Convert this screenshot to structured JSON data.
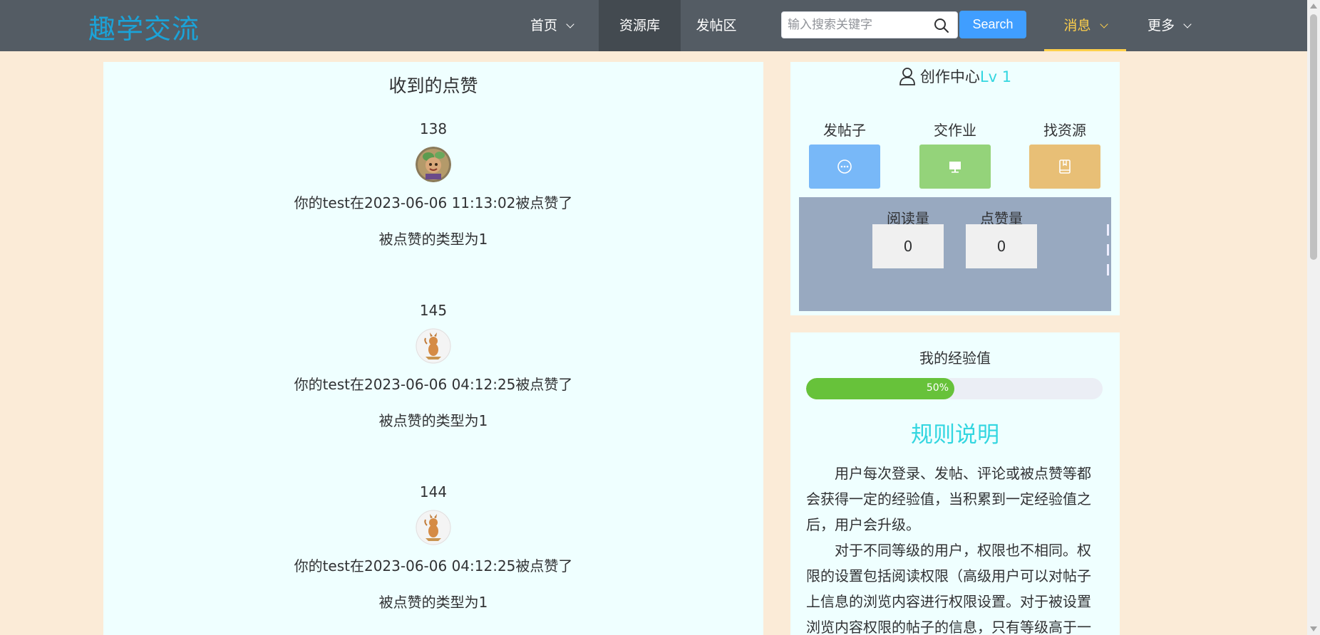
{
  "header": {
    "logo": "趣学交流",
    "nav": {
      "home": "首页",
      "resources": "资源库",
      "posts": "发帖区",
      "messages": "消息",
      "more": "更多"
    },
    "search": {
      "placeholder": "输入搜索关键字",
      "button": "Search"
    }
  },
  "likes": {
    "title": "收到的点赞",
    "items": [
      {
        "id": "138",
        "message": "你的test在2023-06-06 11:13:02被点赞了",
        "type_text": "被点赞的类型为1"
      },
      {
        "id": "145",
        "message": "你的test在2023-06-06 04:12:25被点赞了",
        "type_text": "被点赞的类型为1"
      },
      {
        "id": "144",
        "message": "你的test在2023-06-06 04:12:25被点赞了",
        "type_text": "被点赞的类型为1"
      }
    ]
  },
  "creator": {
    "title": "创作中心",
    "level": "Lv 1",
    "actions": [
      {
        "label": "发帖子",
        "color": "#78b8f8",
        "icon": "chat-icon"
      },
      {
        "label": "交作业",
        "color": "#94d37a",
        "icon": "monitor-icon"
      },
      {
        "label": "找资源",
        "color": "#e8bf76",
        "icon": "notebook-icon"
      }
    ],
    "stats": {
      "reads_label": "阅读量",
      "reads_value": "0",
      "likes_label": "点赞量",
      "likes_value": "0"
    }
  },
  "experience": {
    "title": "我的经验值",
    "progress": 0.5,
    "progress_text": "50%",
    "rules_title": "规则说明",
    "rules_p1": "用户每次登录、发帖、评论或被点赞等都会获得一定的经验值，当积累到一定经验值之后，用户会升级。",
    "rules_p2": "对于不同等级的用户，权限也不相同。权限的设置包括阅读权限（高级用户可以对帖子上信息的浏览内容进行权限设置。对于被设置浏览内容权限的帖子的信息，只有等级高于一"
  },
  "colors": {
    "header_bg": "#545c64",
    "active_nav": "#ffd04b",
    "logo": "#1ba3d8",
    "accent": "#33d6e0",
    "progress": "#67c23a",
    "page_bg": "#fbebd7",
    "panel_bg": "#efffff"
  }
}
